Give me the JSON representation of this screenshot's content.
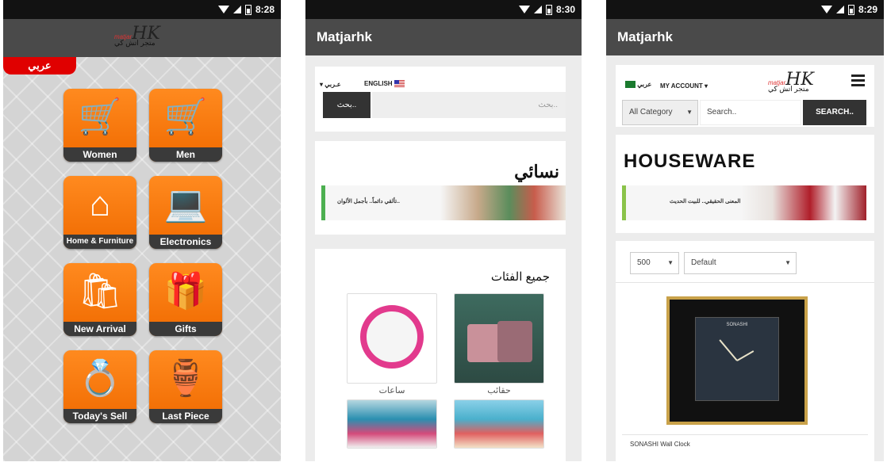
{
  "status": {
    "time1": "8:28",
    "time2": "8:30",
    "time3": "8:29"
  },
  "screen1": {
    "logo": {
      "small": "matjar",
      "mark": "HK",
      "arabic": "متجر اتش كي"
    },
    "lang_tab": "عربي",
    "tiles": [
      {
        "label": "Women",
        "icon": "shopping-cart-icon"
      },
      {
        "label": "Men",
        "icon": "shopping-cart-icon"
      },
      {
        "label": "Home & Furniture",
        "icon": "house-icon"
      },
      {
        "label": "Electronics",
        "icon": "laptop-icon"
      },
      {
        "label": "New Arrival",
        "icon": "bag-icon"
      },
      {
        "label": "Gifts",
        "icon": "gift-icon"
      },
      {
        "label": "Today's Sell",
        "icon": "ring-icon"
      },
      {
        "label": "Last Piece",
        "icon": "vase-icon"
      }
    ]
  },
  "screen2": {
    "title": "Matjarhk",
    "lang_ar": "عـربي",
    "lang_en": "ENGLISH",
    "search_placeholder": "بحث..",
    "search_btn": "بحث..",
    "section_title": "نسائي",
    "banner_text": "تألقي دائماً.. بأجمل الألوان..",
    "categories_title": "جميع الفئات",
    "categories": [
      {
        "label": "ساعات"
      },
      {
        "label": "حقائب"
      },
      {
        "label": ""
      },
      {
        "label": ""
      }
    ]
  },
  "screen3": {
    "title": "Matjarhk",
    "lang_ar": "عربي",
    "account": "MY ACCOUNT",
    "category_select": "All Category",
    "search_placeholder": "Search..",
    "search_btn": "SEARCH..",
    "section_title": "HOUSEWARE",
    "banner_text": "المعنى الحقيقي.. للبيت الحديث ..",
    "count_select": "500",
    "sort_select": "Default",
    "product_name": "SONASHI Wall Clock",
    "clock_brand": "SONASHI"
  }
}
